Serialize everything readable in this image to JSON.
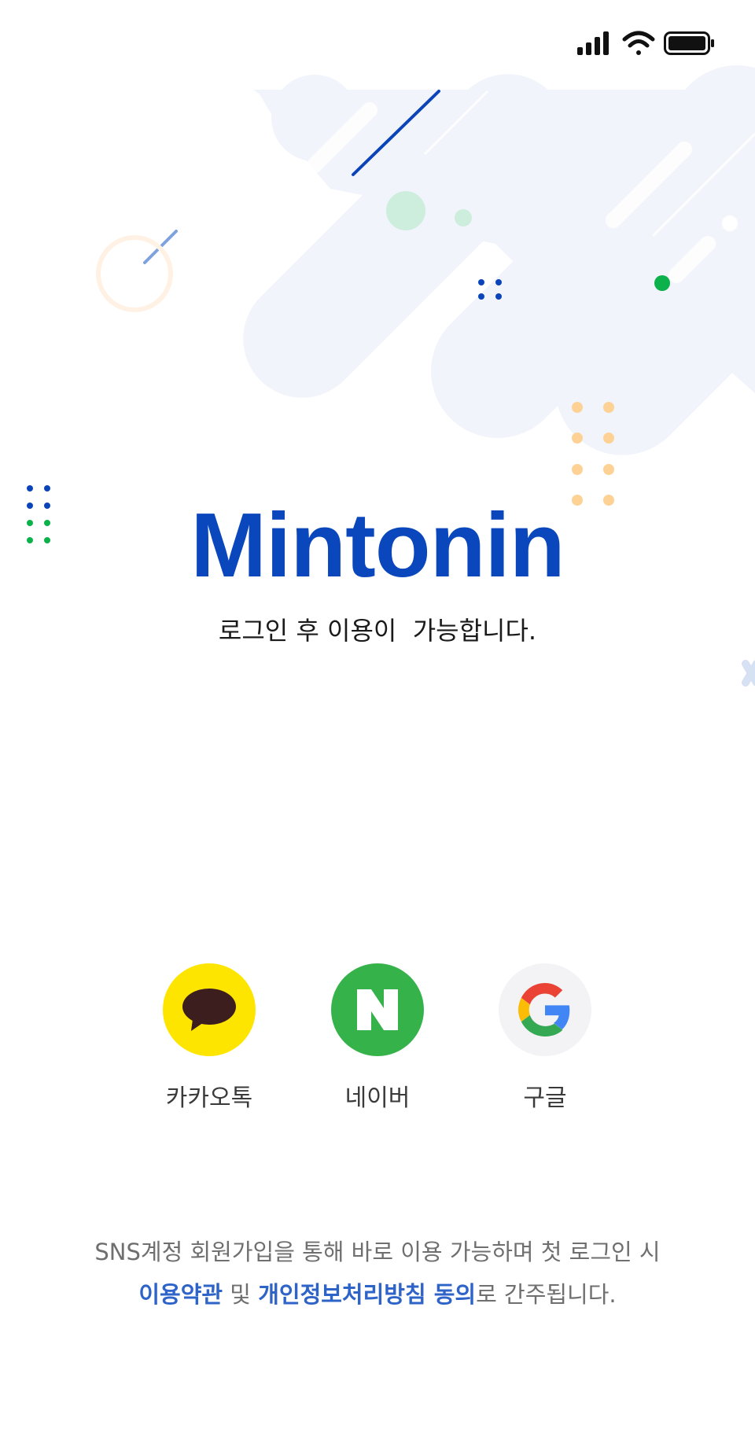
{
  "status_bar": {
    "icons": [
      "signal-icon",
      "wifi-icon",
      "battery-icon"
    ]
  },
  "brand": {
    "logo": "Mintonin",
    "color": "#0a46bc"
  },
  "subtitle": "로그인 후 이용이  가능합니다.",
  "login_options": [
    {
      "label": "카카오톡",
      "icon": "kakaotalk-icon",
      "color": "#fee500"
    },
    {
      "label": "네이버",
      "icon": "naver-icon",
      "color": "#35b34a"
    },
    {
      "label": "구글",
      "icon": "google-icon",
      "color": "#f3f3f6"
    }
  ],
  "notice": {
    "line1": "SNS계정 회원가입을 통해 바로 이용 가능하며 첫 로그인 시",
    "terms_link": "이용약관",
    "and": " 및 ",
    "privacy_link": "개인정보처리방침 동의",
    "suffix": "로 간주됩니다.",
    "link_color": "#2e63c8"
  }
}
